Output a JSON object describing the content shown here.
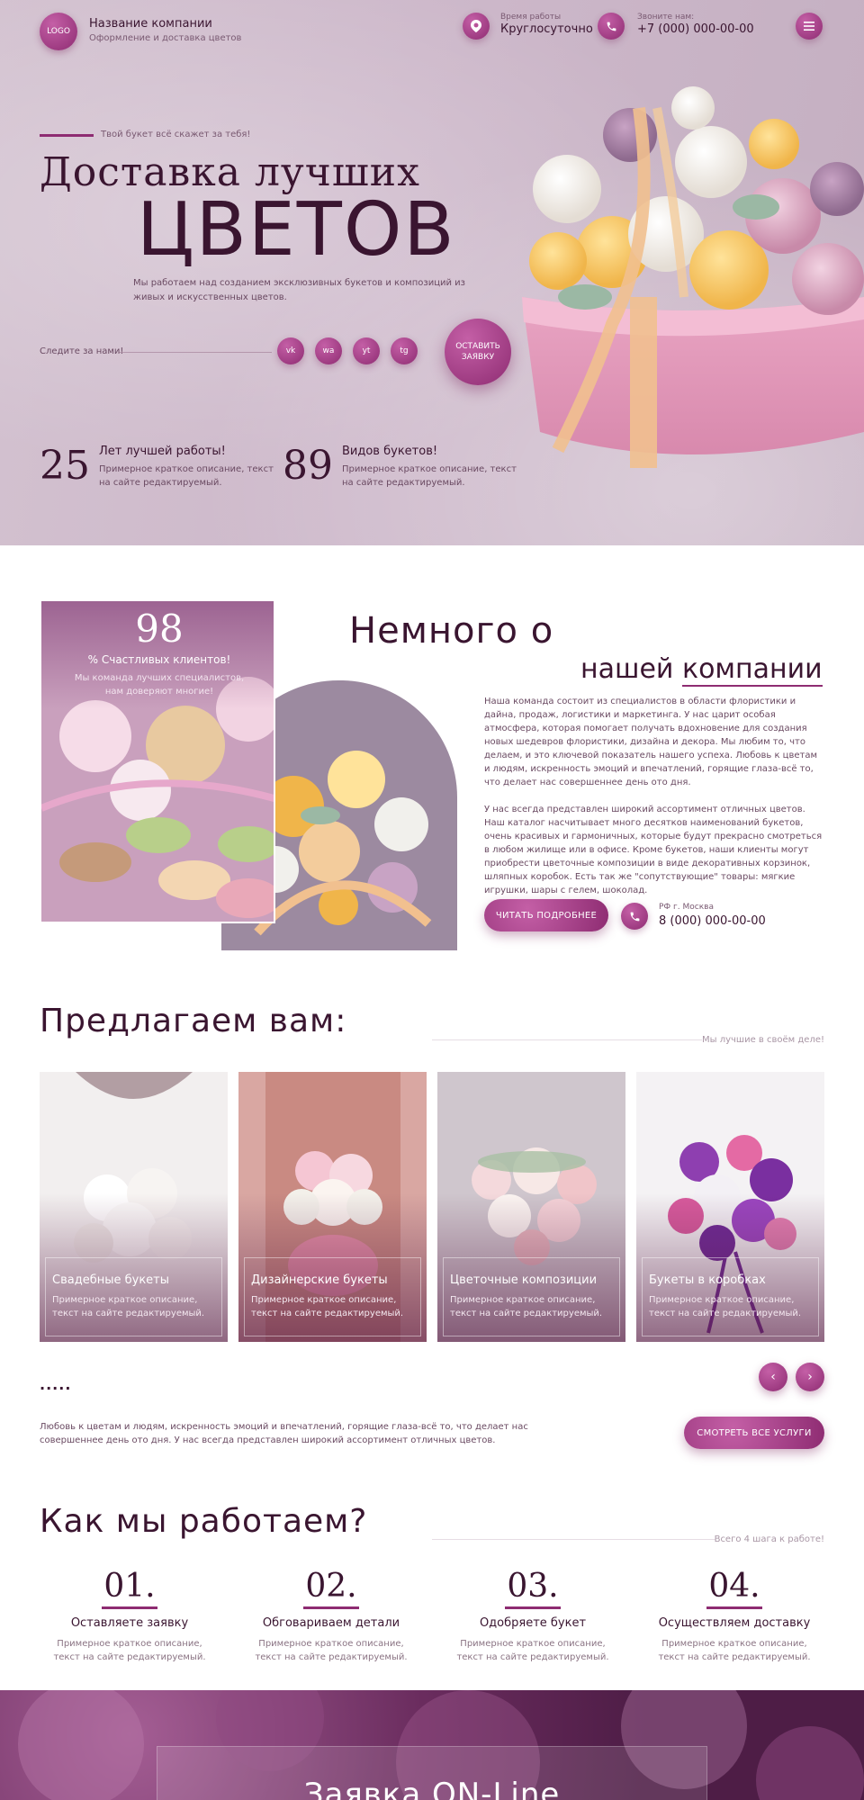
{
  "header": {
    "logo": "LOGO",
    "company_name": "Название компании",
    "company_sub": "Оформление и доставка цветов",
    "hours_label": "Время работы",
    "hours_value": "Круглосуточно",
    "phone_label": "Звоните нам:",
    "phone_value": "+7 (000) 000-00-00"
  },
  "hero": {
    "kicker": "Твой букет всё скажет за тебя!",
    "title_line1": "Доставка лучших",
    "title_line2": "ЦВЕТОВ",
    "description": "Мы работаем над созданием эксклюзивных букетов и композиций из живых и искусственных цветов.",
    "follow_label": "Следите за нами!",
    "socials": [
      "vk",
      "wa",
      "yt",
      "tg"
    ],
    "cta": "ОСТАВИТЬ ЗАЯВКУ",
    "stats": [
      {
        "number": "25",
        "title": "Лет лучшей работы!",
        "text": "Примерное краткое описание, текст на сайте редактируемый."
      },
      {
        "number": "89",
        "title": "Видов букетов!",
        "text": "Примерное краткое описание, текст на сайте редактируемый."
      }
    ]
  },
  "about": {
    "happy_number": "98",
    "happy_label": "% Счастливых клиентов!",
    "happy_sub": "Мы команда лучших специалистов, нам доверяют многие!",
    "title_line1": "Немного о",
    "title_line2a": "нашей",
    "title_line2b": "компании",
    "para1": "Наша команда состоит из специалистов в области флористики и дайна, продаж, логистики и маркетинга. У нас царит особая атмосфера, которая помогает получать вдохновение для создания новых шедевров флористики, дизайна и декора. Мы любим то, что делаем, и это ключевой показатель нашего успеха. Любовь к цветам и людям, искренность эмоций и впечатлений, горящие глаза-всё то, что делает нас совершеннее день ото дня.",
    "para2": "У нас всегда представлен широкий ассортимент отличных цветов. Наш каталог насчитывает много десятков наименований букетов, очень красивых и гармоничных, которые будут прекрасно смотреться в любом жилище или в офисе. Кроме букетов, наши клиенты могут приобрести цветочные композиции в виде декоративных корзинок, шляпных коробок. Есть так же \"сопутствующие\" товары: мягкие игрушки, шары с гелем, шоколад.",
    "read_more": "ЧИТАТЬ ПОДРОБНЕЕ",
    "location": "РФ г. Москва",
    "phone": "8 (000) 000-00-00"
  },
  "services": {
    "title": "Предлагаем вам:",
    "note": "Мы лучшие в своём деле!",
    "cards": [
      {
        "title": "Свадебные букеты",
        "desc": "Примерное краткое описание, текст на сайте редактируемый."
      },
      {
        "title": "Дизайнерские букеты",
        "desc": "Примерное краткое описание, текст на сайте редактируемый."
      },
      {
        "title": "Цветочные композиции",
        "desc": "Примерное краткое описание, текст на сайте редактируемый."
      },
      {
        "title": "Букеты в коробках",
        "desc": "Примерное краткое описание, текст на сайте редактируемый."
      }
    ],
    "dots": ".....",
    "text": "Любовь к цветам и людям, искренность эмоций и впечатлений, горящие глаза-всё то, что делает нас совершеннее день ото дня. У нас всегда представлен широкий ассортимент отличных цветов.",
    "all_button": "СМОТРЕТЬ ВСЕ УСЛУГИ"
  },
  "steps": {
    "title": "Как мы работаем?",
    "note": "Всего 4 шага к работе!",
    "items": [
      {
        "num": "01.",
        "title": "Оставляете заявку",
        "desc": "Примерное краткое описание, текст на сайте редактируемый."
      },
      {
        "num": "02.",
        "title": "Обговариваем детали",
        "desc": "Примерное краткое описание, текст на сайте редактируемый."
      },
      {
        "num": "03.",
        "title": "Одобряете букет",
        "desc": "Примерное краткое описание, текст на сайте редактируемый."
      },
      {
        "num": "04.",
        "title": "Осуществляем доставку",
        "desc": "Примерное краткое описание, текст на сайте редактируемый."
      }
    ]
  },
  "order": {
    "title": "Заявка ON-Line"
  },
  "colors": {
    "accent": "#8e2c72",
    "accent_light": "#c45fa6",
    "text_dark": "#3a1530",
    "hero_bg": "#cdb8ca"
  },
  "icons": {
    "clock": "clock-icon",
    "phone": "phone-icon",
    "menu": "menu-icon",
    "arrow_prev": "arrow-left-icon",
    "arrow_next": "arrow-right-icon"
  }
}
